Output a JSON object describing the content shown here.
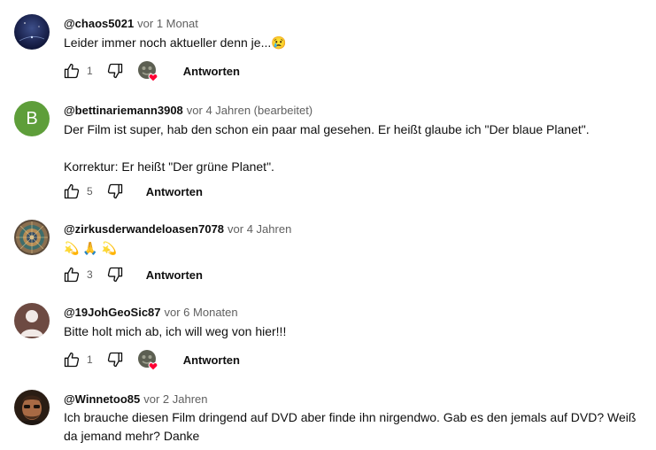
{
  "comments": [
    {
      "handle": "@chaos5021",
      "time": "vor 1 Monat",
      "text": "Leider immer noch aktueller denn je...",
      "emoji": "😢",
      "likes": "1",
      "reply_label": "Antworten",
      "creator_heart": true,
      "avatar": "night-sky"
    },
    {
      "handle": "@bettinariemann3908",
      "time": "vor 4 Jahren (bearbeitet)",
      "text_line1": "Der Film ist super, hab den schon ein paar mal gesehen. Er heißt glaube ich \"Der blaue Planet\".",
      "text_line2": "Korrektur: Er heißt \"Der grüne Planet\".",
      "likes": "5",
      "reply_label": "Antworten",
      "avatar_letter": "B",
      "avatar_color": "#5e9e3a"
    },
    {
      "handle": "@zirkusderwandeloasen7078",
      "time": "vor 4 Jahren",
      "text": "💫 🙏 💫",
      "likes": "3",
      "reply_label": "Antworten",
      "avatar": "mandala"
    },
    {
      "handle": "@19JohGeoSic87",
      "time": "vor 6 Monaten",
      "text": "Bitte holt mich ab, ich will weg von hier!!!",
      "likes": "1",
      "reply_label": "Antworten",
      "creator_heart": true,
      "avatar": "default-person"
    },
    {
      "handle": "@Winnetoo85",
      "time": "vor 2 Jahren",
      "text": "Ich brauche diesen Film dringend auf DVD aber finde ihn nirgendwo. Gab es den jemals auf DVD? Weiß da jemand mehr? Danke",
      "avatar": "photo-man"
    }
  ],
  "colors": {
    "text": "#0f0f0f",
    "meta": "#606060",
    "heart": "#ff0033",
    "avatar_b": "#5e9e3a"
  },
  "icons": [
    "thumbs-up-icon",
    "thumbs-down-icon",
    "creator-heart-icon"
  ]
}
